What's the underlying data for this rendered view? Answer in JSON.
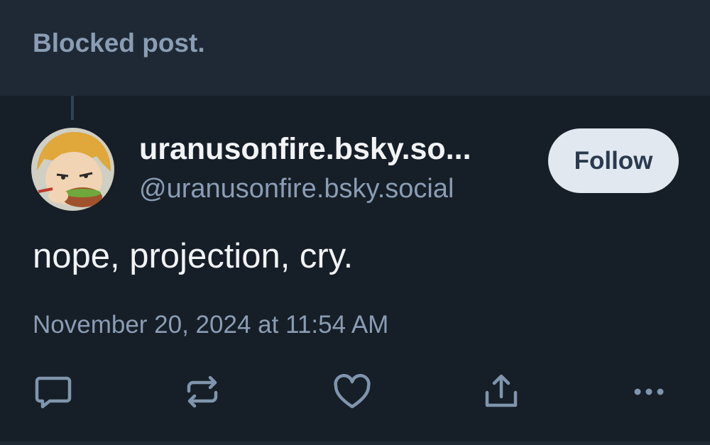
{
  "blocked_notice": "Blocked post.",
  "author": {
    "display_name": "uranusonfire.bsky.so...",
    "handle": "@uranusonfire.bsky.social",
    "avatar": "avatar-icon"
  },
  "follow_label": "Follow",
  "post_text": "nope, projection, cry.",
  "timestamp": "November 20, 2024 at 11:54 AM",
  "actions": [
    {
      "icon": "reply-icon"
    },
    {
      "icon": "repost-icon"
    },
    {
      "icon": "like-icon"
    },
    {
      "icon": "share-icon"
    },
    {
      "icon": "more-icon"
    }
  ],
  "colors": {
    "background": "#161e27",
    "blocked_background": "#1e2935",
    "muted_text": "#8a9db4",
    "primary_text": "#f1f3f5",
    "button_bg": "#e2e8f0",
    "button_text": "#2a3a4e"
  }
}
